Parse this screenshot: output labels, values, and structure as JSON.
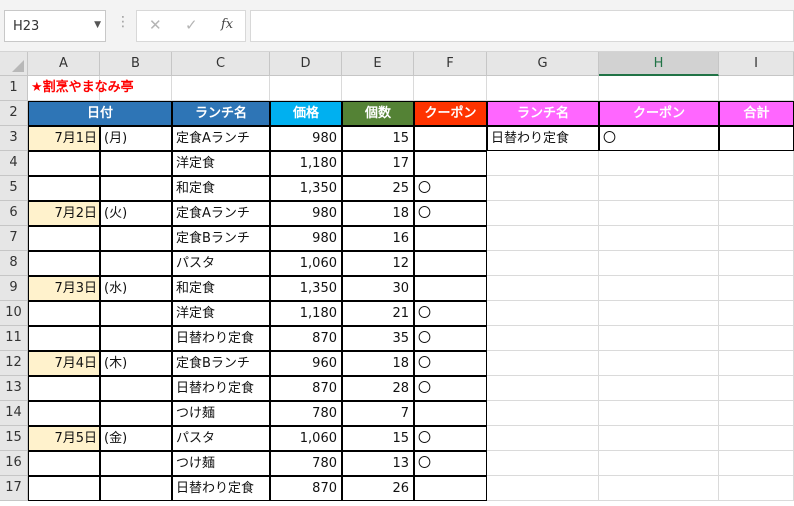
{
  "name_box": {
    "value": "H23"
  },
  "formula_bar": {
    "cancel_icon": "✕",
    "enter_icon": "✓",
    "fx_label": "fx",
    "value": ""
  },
  "columns": [
    "A",
    "B",
    "C",
    "D",
    "E",
    "F",
    "G",
    "H",
    "I"
  ],
  "selected_column": "H",
  "rows": [
    "1",
    "2",
    "3",
    "4",
    "5",
    "6",
    "7",
    "8",
    "9",
    "10",
    "11",
    "12",
    "13",
    "14",
    "15",
    "16",
    "17"
  ],
  "sheet": {
    "title": "★割烹やまなみ亭",
    "headers": {
      "date": "日付",
      "lunch": "ランチ名",
      "price": "価格",
      "count": "個数",
      "coupon": "クーポン",
      "lunch2": "ランチ名",
      "coupon2": "クーポン",
      "total": "合計"
    },
    "records": [
      {
        "date": "7月1日",
        "dow": "(月)",
        "lunch": "定食Aランチ",
        "price": "980",
        "count": "15",
        "coupon": ""
      },
      {
        "date": "",
        "dow": "",
        "lunch": "洋定食",
        "price": "1,180",
        "count": "17",
        "coupon": ""
      },
      {
        "date": "",
        "dow": "",
        "lunch": "和定食",
        "price": "1,350",
        "count": "25",
        "coupon": "〇"
      },
      {
        "date": "7月2日",
        "dow": "(火)",
        "lunch": "定食Aランチ",
        "price": "980",
        "count": "18",
        "coupon": "〇"
      },
      {
        "date": "",
        "dow": "",
        "lunch": "定食Bランチ",
        "price": "980",
        "count": "16",
        "coupon": ""
      },
      {
        "date": "",
        "dow": "",
        "lunch": "パスタ",
        "price": "1,060",
        "count": "12",
        "coupon": ""
      },
      {
        "date": "7月3日",
        "dow": "(水)",
        "lunch": "和定食",
        "price": "1,350",
        "count": "30",
        "coupon": ""
      },
      {
        "date": "",
        "dow": "",
        "lunch": "洋定食",
        "price": "1,180",
        "count": "21",
        "coupon": "〇"
      },
      {
        "date": "",
        "dow": "",
        "lunch": "日替わり定食",
        "price": "870",
        "count": "35",
        "coupon": "〇"
      },
      {
        "date": "7月4日",
        "dow": "(木)",
        "lunch": "定食Bランチ",
        "price": "960",
        "count": "18",
        "coupon": "〇"
      },
      {
        "date": "",
        "dow": "",
        "lunch": "日替わり定食",
        "price": "870",
        "count": "28",
        "coupon": "〇"
      },
      {
        "date": "",
        "dow": "",
        "lunch": "つけ麺",
        "price": "780",
        "count": "7",
        "coupon": ""
      },
      {
        "date": "7月5日",
        "dow": "(金)",
        "lunch": "パスタ",
        "price": "1,060",
        "count": "15",
        "coupon": "〇"
      },
      {
        "date": "",
        "dow": "",
        "lunch": "つけ麺",
        "price": "780",
        "count": "13",
        "coupon": "〇"
      },
      {
        "date": "",
        "dow": "",
        "lunch": "日替わり定食",
        "price": "870",
        "count": "26",
        "coupon": ""
      }
    ],
    "criteria": {
      "lunch": "日替わり定食",
      "coupon": "〇",
      "total": ""
    }
  }
}
